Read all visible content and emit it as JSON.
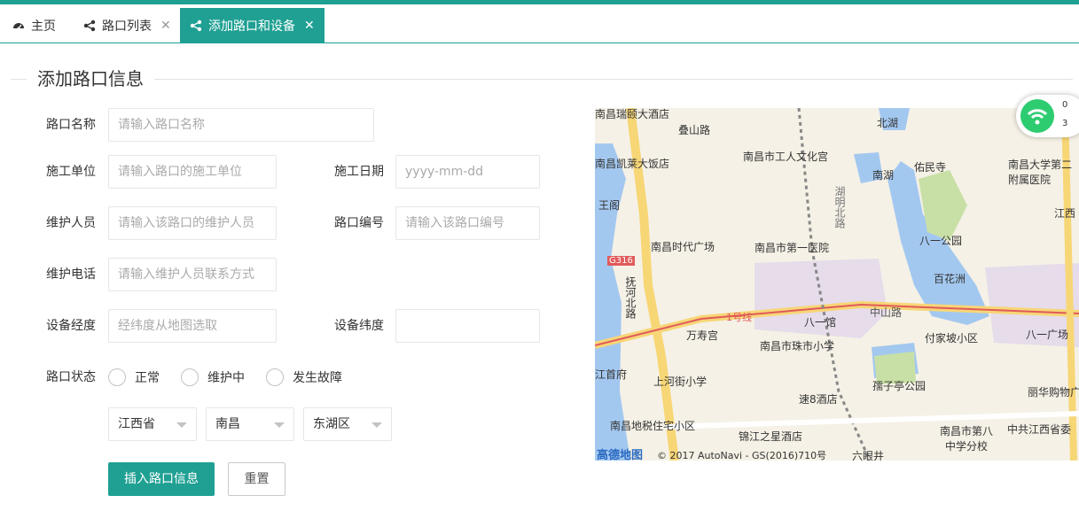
{
  "tabs": [
    {
      "label": "主页",
      "icon": "dashboard-icon",
      "closable": false,
      "active": false
    },
    {
      "label": "路口列表",
      "icon": "share-icon",
      "closable": true,
      "active": false
    },
    {
      "label": "添加路口和设备",
      "icon": "share-icon",
      "closable": true,
      "active": true
    }
  ],
  "close_glyph": "✕",
  "section_title": "添加路口信息",
  "form": {
    "name": {
      "label": "路口名称",
      "placeholder": "请输入路口名称"
    },
    "unit": {
      "label": "施工单位",
      "placeholder": "请输入路口的施工单位"
    },
    "date": {
      "label": "施工日期",
      "placeholder": "yyyy-mm-dd"
    },
    "maintainer": {
      "label": "维护人员",
      "placeholder": "请输入该路口的维护人员"
    },
    "code": {
      "label": "路口编号",
      "placeholder": "请输入该路口编号"
    },
    "phone": {
      "label": "维护电话",
      "placeholder": "请输入维护人员联系方式"
    },
    "lng": {
      "label": "设备经度",
      "placeholder": "经纬度从地图选取"
    },
    "lat": {
      "label": "设备纬度",
      "placeholder": ""
    },
    "status": {
      "label": "路口状态",
      "options": [
        "正常",
        "维护中",
        "发生故障"
      ]
    },
    "province": "江西省",
    "city": "南昌",
    "district": "东湖区",
    "submit": "插入路口信息",
    "reset": "重置"
  },
  "map": {
    "labels": [
      "南昌瑞颐大酒店",
      "叠山路",
      "北湖",
      "南昌市工人文化宫",
      "南昌凯莱大饭店",
      "南湖",
      "佑民寺",
      "南昌大学第二附属医院",
      "王阁",
      "南昌时代广场",
      "南昌市第一医院",
      "八一公园",
      "江西",
      "G316",
      "百花洲",
      "抚河北路",
      "中山路",
      "1号线",
      "八一馆",
      "万寿宫",
      "南昌市珠市小学",
      "付家坡小区",
      "八一广场",
      "上河街小学",
      "孺子亭公园",
      "丽华购物广",
      "速8酒店",
      "南昌地税住宅小区",
      "锦江之星酒店",
      "南昌市第八中学分校",
      "中共江西省委",
      "六眼井",
      "湖明北路",
      "江首府"
    ],
    "copyright": "© 2017 AutoNavi - GS(2016)710号",
    "logo": "高德地图",
    "road_color": "#f7d676",
    "water_color": "#a3c8f0",
    "park_color": "#c8e0a6",
    "metro_color": "#e05a5a"
  },
  "widget": {
    "line1": "0",
    "line2": "3"
  },
  "colors": {
    "accent": "#1fa093"
  }
}
